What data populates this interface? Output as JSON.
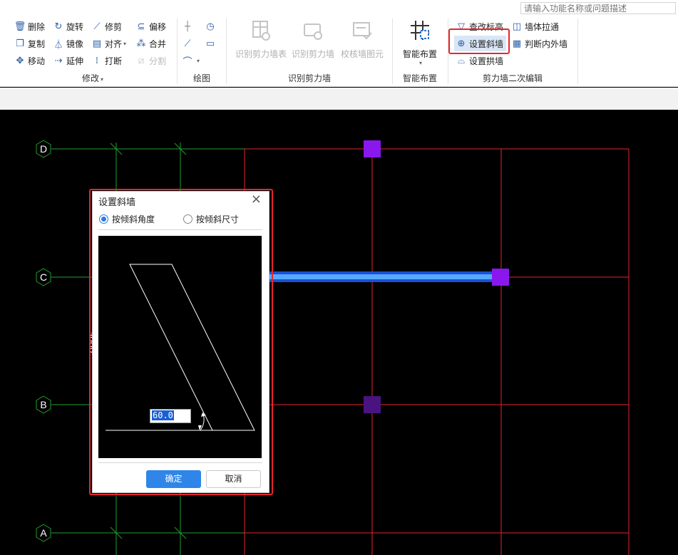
{
  "search": {
    "placeholder": "请输入功能名称或问题描述"
  },
  "ribbon": {
    "modify": {
      "title": "修改",
      "items": {
        "delete": "删除",
        "rotate": "旋转",
        "trim": "修剪",
        "offset": "偏移",
        "copy": "复制",
        "mirror": "镜像",
        "align": "对齐",
        "merge": "合并",
        "move": "移动",
        "extend": "延伸",
        "break": "打断",
        "split": "分割"
      }
    },
    "draw": {
      "title": "绘图"
    },
    "recognize": {
      "title": "识别剪力墙",
      "items": {
        "table": "识别剪力墙表",
        "wall": "识别剪力墙",
        "check": "校核墙图元"
      }
    },
    "smart": {
      "title": "智能布置",
      "label": "智能布置"
    },
    "edit2": {
      "title": "剪力墙二次编辑",
      "items": {
        "elevation": "查改标高",
        "stretch": "墙体拉通",
        "slant": "设置斜墙",
        "inout": "判断内外墙",
        "arch": "设置拱墙"
      }
    }
  },
  "canvas": {
    "axes": {
      "d": "D",
      "c": "C",
      "b": "B",
      "a": "A"
    },
    "dimension": "9000"
  },
  "dialog": {
    "title": "设置斜墙",
    "radio_angle": "按倾斜角度",
    "radio_size": "按倾斜尺寸",
    "angle_value": "60.0",
    "ok": "确定",
    "cancel": "取消"
  }
}
